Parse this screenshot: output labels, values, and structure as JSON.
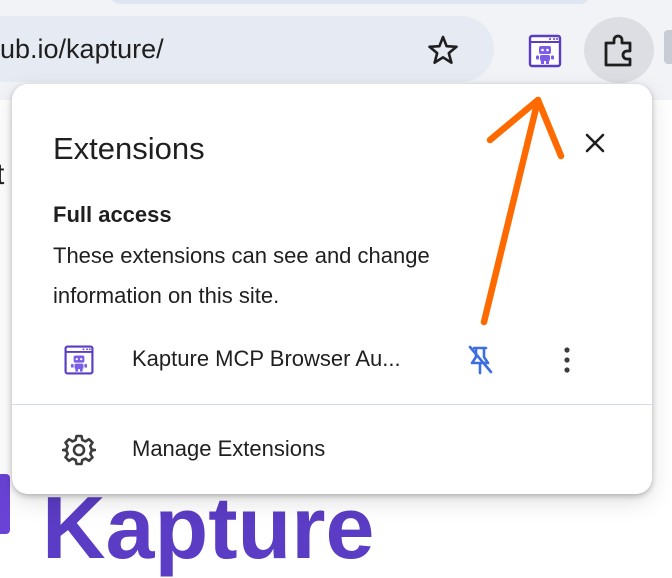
{
  "browser": {
    "url_text": "ub.io/kapture/",
    "icons": {
      "bookmark": "star-icon",
      "pinned_extension": "robot-icon",
      "extensions_menu": "puzzle-icon"
    }
  },
  "page_behind": {
    "glimpse_letter": "t",
    "logo_text": "Kapture"
  },
  "extensions_popup": {
    "title": "Extensions",
    "close_icon": "close-icon",
    "section": {
      "heading": "Full access",
      "description": "These extensions can see and change information on this site."
    },
    "extensions": [
      {
        "name": "Kapture MCP Browser Au...",
        "icon": "robot-icon",
        "pin_icon": "unpin-icon",
        "menu_icon": "more-vertical-icon"
      }
    ],
    "manage": {
      "label": "Manage Extensions",
      "icon": "gear-icon"
    }
  },
  "annotation": {
    "arrow_color": "#ff6a00"
  },
  "colors": {
    "toolbar_bg": "#f1f3f7",
    "omnibox_bg": "#e6eaf2",
    "accent_purple": "#5b3cc4",
    "pin_blue": "#3b6fe0"
  }
}
